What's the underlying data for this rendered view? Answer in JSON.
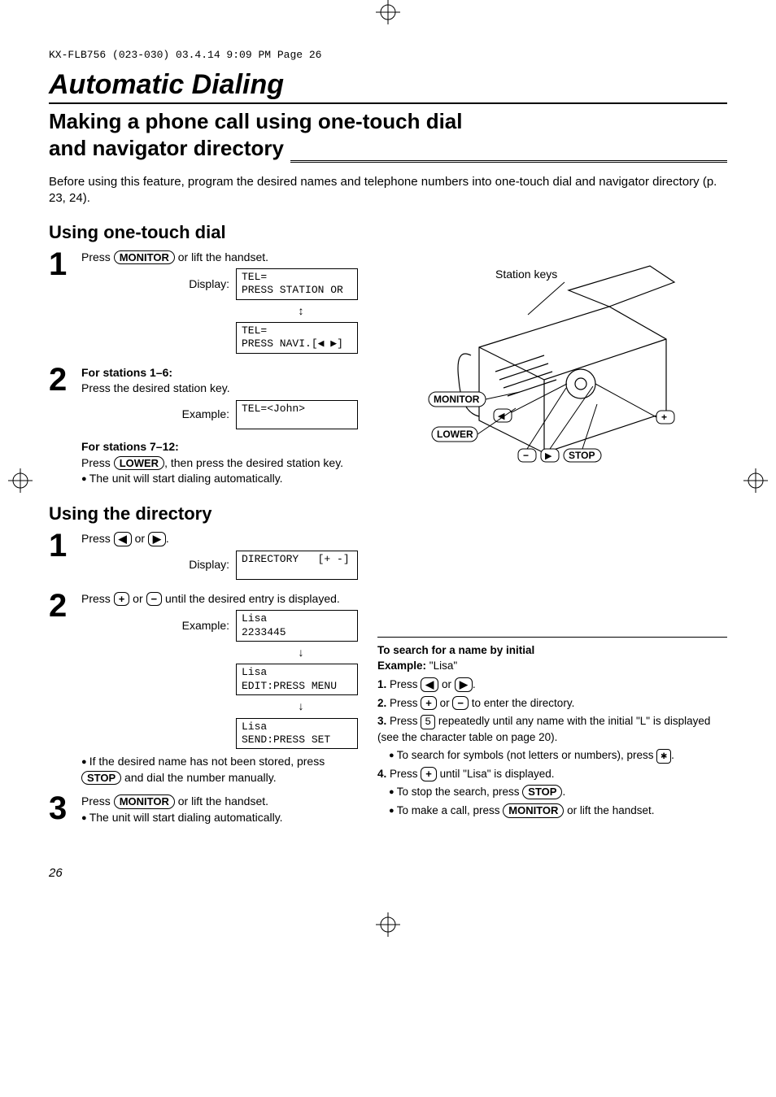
{
  "header": "KX-FLB756 (023-030)  03.4.14  9:09 PM  Page 26",
  "title": "Automatic Dialing",
  "subtitle_line1": "Making a phone call using one-touch dial",
  "subtitle_line2": "and navigator directory",
  "intro": "Before using this feature, program the desired names and telephone numbers into one-touch dial and navigator directory (p. 23, 24).",
  "sec1": {
    "heading": "Using one-touch dial",
    "step1_pre": "Press ",
    "step1_key": "MONITOR",
    "step1_post": " or lift the handset.",
    "display_label": "Display:",
    "lcd1": "TEL=\nPRESS STATION OR",
    "lcd2": "TEL=\nPRESS NAVI.[◀ ▶]",
    "step2_h1": "For stations 1–6:",
    "step2_t1": "Press the desired station key.",
    "example_label": "Example:",
    "lcd_ex": "TEL=<John>",
    "step2_h2": "For stations 7–12:",
    "step2_t2a": "Press ",
    "step2_key": "LOWER",
    "step2_t2b": ", then press the desired station key.",
    "step2_bullet": "The unit will start dialing automatically."
  },
  "sec2": {
    "heading": "Using the directory",
    "step1_pre": "Press ",
    "step1_or": " or ",
    "step1_post": ".",
    "display_label": "Display:",
    "lcd1": "DIRECTORY   [+ -]",
    "step2_pre": "Press ",
    "step2_mid": " or ",
    "step2_post": " until the desired entry is displayed.",
    "example_label": "Example:",
    "lcd_a": "Lisa\n2233445",
    "lcd_b": "Lisa\nEDIT:PRESS MENU",
    "lcd_c": "Lisa\nSEND:PRESS SET",
    "step2_bullet_pre": "If the desired name has not been stored, press ",
    "step2_bullet_key": "STOP",
    "step2_bullet_post": " and dial the number manually.",
    "step3_pre": "Press ",
    "step3_key": "MONITOR",
    "step3_post": " or lift the handset.",
    "step3_bullet": "The unit will start dialing automatically."
  },
  "illus": {
    "station_keys": "Station keys",
    "monitor": "MONITOR",
    "lower": "LOWER",
    "stop": "STOP",
    "plus": "+",
    "minus": "−",
    "left": "◀",
    "right": "▶"
  },
  "sidebox": {
    "heading": "To search for a name by initial",
    "ex_label": "Example:",
    "ex_val": " \"Lisa\"",
    "s1_pre": "Press ",
    "s1_or": " or ",
    "s1_post": ".",
    "s2_pre": "Press ",
    "s2_or": " or ",
    "s2_post": " to enter the directory.",
    "s3_pre": "Press ",
    "s3_key": "5",
    "s3_post": " repeatedly until any name with the initial \"L\" is displayed (see the character table on page 20).",
    "s3_sub_pre": "To search for symbols (not letters or numbers), press ",
    "s3_sub_key": "✱",
    "s3_sub_post": ".",
    "s4_pre": "Press ",
    "s4_post": " until \"Lisa\" is displayed.",
    "s4_sub1_pre": "To stop the search, press ",
    "s4_sub1_key": "STOP",
    "s4_sub1_post": ".",
    "s4_sub2_pre": "To make a call, press ",
    "s4_sub2_key": "MONITOR",
    "s4_sub2_post": " or lift the handset."
  },
  "pagenum": "26",
  "icons": {
    "left": "◀",
    "right": "▶",
    "plus": "+",
    "minus": "−",
    "updown": "↕",
    "down": "↓"
  }
}
